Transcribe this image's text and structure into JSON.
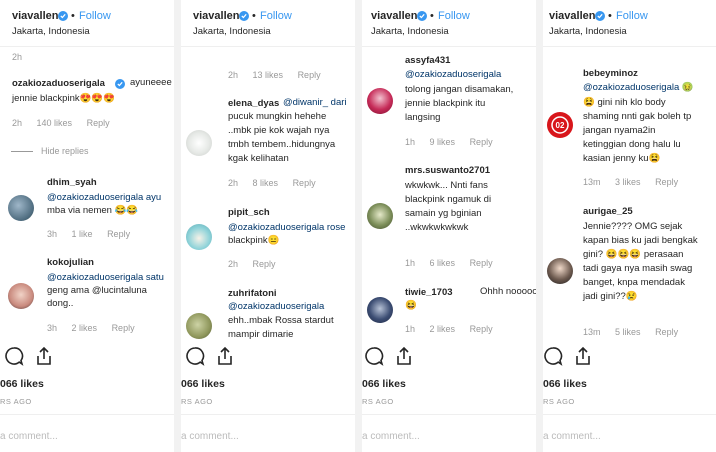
{
  "panels": [
    {
      "username": "viavallen",
      "follow": "Follow",
      "location": "Jakarta, Indonesia",
      "top_time": "2h",
      "comments": [
        {
          "user": "ozakiozaduoserigala",
          "verified": true,
          "lines": [
            "ayuneeee",
            "jennie blackpink😍😍😍"
          ],
          "time": "2h",
          "likes": "140 likes",
          "reply": "Reply"
        },
        {
          "user": "dhim_syah",
          "lines": [
            "@ozakiozaduoserigala ayu",
            "mba via nemen 😂😂"
          ],
          "time": "3h",
          "likes": "1 like",
          "reply": "Reply"
        },
        {
          "user": "kokojulian",
          "lines": [
            "@ozakiozaduoserigala satu",
            "geng ama @lucintaluna",
            "dong.."
          ],
          "time": "3h",
          "likes": "2 likes",
          "reply": "Reply"
        }
      ],
      "hide_replies": "Hide replies",
      "likes_count": "066 likes",
      "ago": "RS AGO",
      "add_comment": "a comment..."
    },
    {
      "username": "viavallen",
      "follow": "Follow",
      "location": "Jakarta, Indonesia",
      "top_time": "2h",
      "top_likes": "13 likes",
      "top_reply": "Reply",
      "comments": [
        {
          "user": "elena_dyas",
          "lines": [
            "@diwanir_ dari",
            "pucuk mungkin hehehe",
            "..mbk pie kok wajah nya",
            "tmbh tembem..hidungnya",
            "kgak kelihatan"
          ],
          "time": "2h",
          "likes": "8 likes",
          "reply": "Reply"
        },
        {
          "user": "pipit_sch",
          "lines": [
            "@ozakiozaduoserigala rose",
            "blackpink😑"
          ],
          "time": "2h",
          "likes": "",
          "reply": "Reply"
        },
        {
          "user": "zuhrifatoni",
          "lines": [
            "@ozakiozaduoserigala",
            "ehh..mbak Rossa stardut",
            "mampir dimarie"
          ],
          "time": "",
          "likes": "",
          "reply": ""
        }
      ],
      "likes_count": "066 likes",
      "ago": "RS AGO",
      "add_comment": "a comment..."
    },
    {
      "username": "viavallen",
      "follow": "Follow",
      "location": "Jakarta, Indonesia",
      "comments": [
        {
          "user": "assyfa431",
          "lines": [
            "@ozakiozaduoserigala",
            "tolong jangan disamakan,",
            "jennie blackpink itu",
            "langsing"
          ],
          "time": "1h",
          "likes": "9 likes",
          "reply": "Reply"
        },
        {
          "user": "mrs.suswanto2701",
          "lines": [
            "wkwkwk... Nnti fans",
            "blackpink ngamuk di",
            "samain yg bginian",
            "..wkwkwkwkwk"
          ],
          "time": "1h",
          "likes": "6 likes",
          "reply": "Reply"
        },
        {
          "user": "tiwie_1703",
          "lines": [
            "Ohhh nooooo",
            "😆"
          ],
          "time": "1h",
          "likes": "2 likes",
          "reply": "Reply"
        }
      ],
      "likes_count": "066 likes",
      "ago": "RS AGO",
      "add_comment": "a comment..."
    },
    {
      "username": "viavallen",
      "follow": "Follow",
      "location": "Jakarta, Indonesia",
      "comments": [
        {
          "user": "bebeyminoz",
          "lines": [
            "@ozakiozaduoserigala 🤢",
            "😫 gini nih klo body",
            "shaming nnti gak boleh tp",
            "jangan nyama2in",
            "ketinggian dong halu lu",
            "kasian jenny ku😫"
          ],
          "time": "13m",
          "likes": "3 likes",
          "reply": "Reply"
        },
        {
          "user": "aurigae_25",
          "lines": [
            "Jennie???? OMG sejak",
            "kapan bias ku jadi bengkak",
            "gini? 😆😆😆 perasaan",
            "tadi gaya nya masih swag",
            "banget, knpa mendadak",
            "jadi gini??😢"
          ],
          "time": "13m",
          "likes": "5 likes",
          "reply": "Reply"
        }
      ],
      "likes_count": "066 likes",
      "ago": "RS AGO",
      "add_comment": "a comment..."
    }
  ],
  "colors": {
    "link": "#3897f0",
    "mention": "#003569",
    "meta": "#999999",
    "text": "#262626"
  },
  "icons": [
    "verified-badge-icon",
    "comment-icon",
    "share-icon"
  ]
}
